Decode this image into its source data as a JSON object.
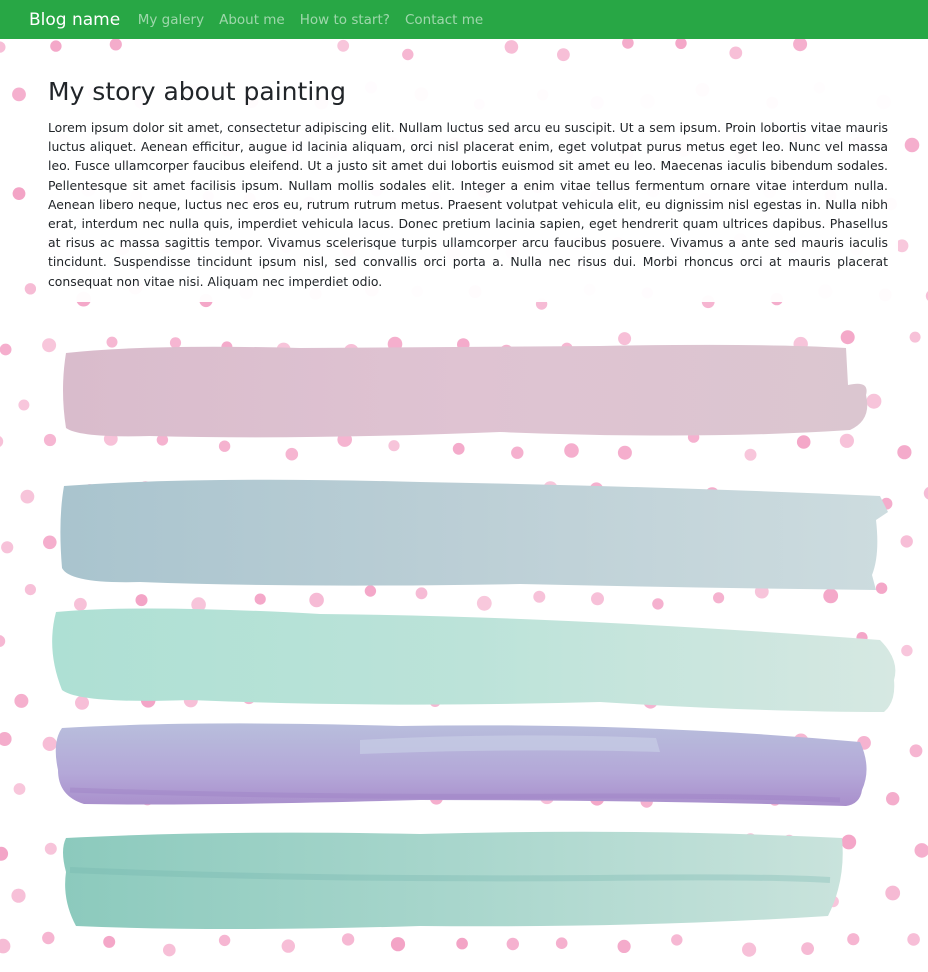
{
  "navbar": {
    "brand": "Blog name",
    "links": [
      "My galery",
      "About me",
      "How to start?",
      "Contact me"
    ],
    "color": "#28a745"
  },
  "main": {
    "title": "My story about painting",
    "body": "Lorem ipsum dolor sit amet, consectetur adipiscing elit. Nullam luctus sed arcu eu suscipit. Ut a sem ipsum. Proin lobortis vitae mauris luctus aliquet. Aenean efficitur, augue id lacinia aliquam, orci nisl placerat enim, eget volutpat purus metus eget leo. Nunc vel massa leo. Fusce ullamcorper faucibus eleifend. Ut a justo sit amet dui lobortis euismod sit amet eu leo. Maecenas iaculis bibendum sodales. Pellentesque sit amet facilisis ipsum. Nullam mollis sodales elit. Integer a enim vitae tellus fermentum ornare vitae interdum nulla. Aenean libero neque, luctus nec eros eu, rutrum rutrum metus. Praesent volutpat vehicula elit, eu dignissim nisl egestas in. Nulla nibh erat, interdum nec nulla quis, imperdiet vehicula lacus. Donec pretium lacinia sapien, eget hendrerit quam ultrices dapibus. Phasellus at risus ac massa sagittis tempor. Vivamus scelerisque turpis ullamcorper arcu faucibus posuere. Vivamus a ante sed mauris iaculis tincidunt. Suspendisse tincidunt ipsum nisl, sed convallis orci porta a. Nulla nec risus dui. Morbi rhoncus orci at mauris placerat consequat non vitae nisi. Aliquam nec imperdiet odio."
  },
  "background": {
    "dot_color": "#f29ac0",
    "stroke_colors": [
      "#dbbfcf",
      "#b9cdd4",
      "#b7e0d8",
      "#b2a6d6",
      "#9fd0c8"
    ]
  }
}
